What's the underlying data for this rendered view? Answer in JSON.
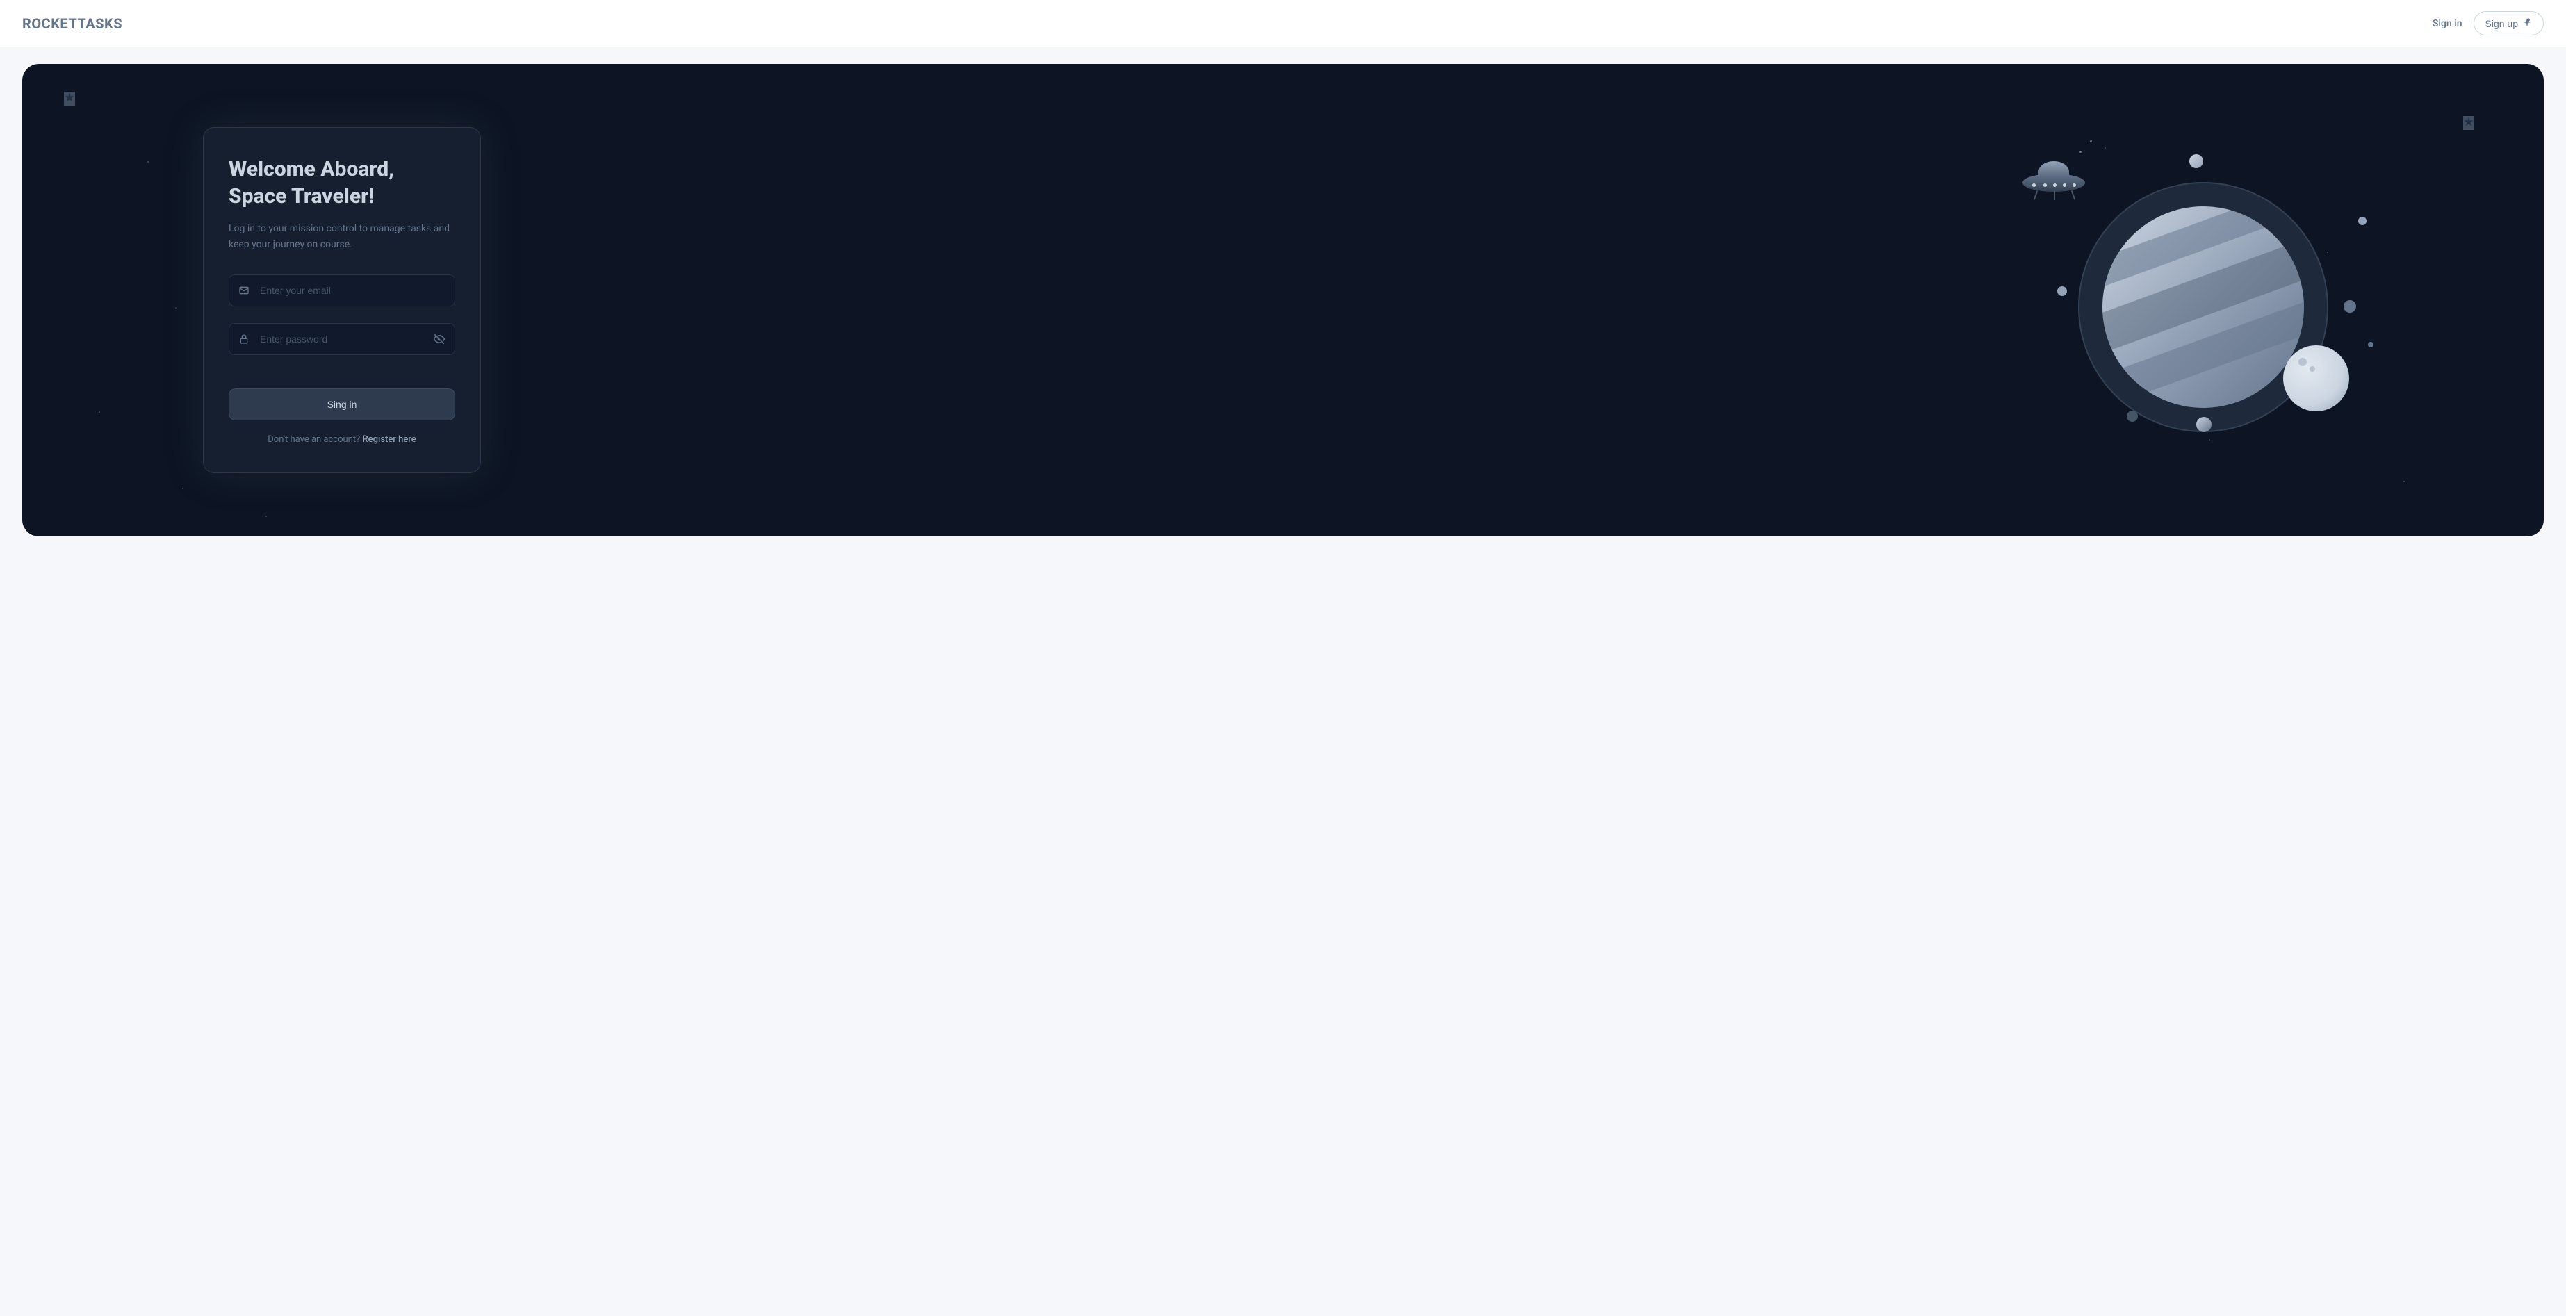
{
  "header": {
    "logo": "ROCKETTASKS",
    "signin_label": "Sign in",
    "signup_label": "Sign up"
  },
  "login": {
    "title": "Welcome Aboard, Space Traveler!",
    "subtitle": "Log in to your mission control to manage tasks and keep your journey on course.",
    "email_placeholder": "Enter your email",
    "password_placeholder": "Enter password",
    "submit_label": "Sing in",
    "register_prompt": "Don't have an account? ",
    "register_link_label": "Register here"
  }
}
